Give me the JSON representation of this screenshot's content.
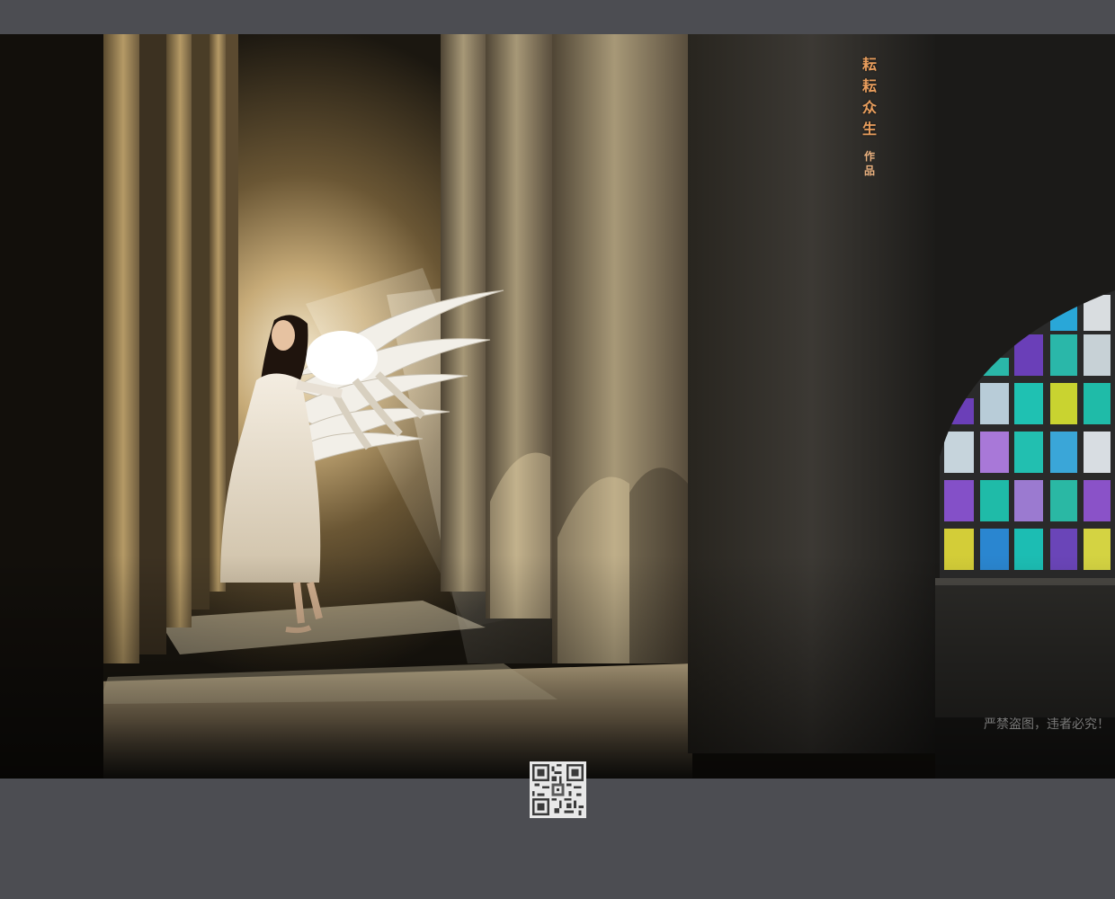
{
  "title_chars": [
    "耘",
    "耘",
    "众",
    "生"
  ],
  "works_chars": [
    "作",
    "品"
  ],
  "watermark_text": "严禁盗图，违者必究！",
  "scene_icons": {
    "photo": "angel-dancer-photo-icon",
    "qr": "qr-code-icon"
  },
  "colors": {
    "frame": "#4c4d52",
    "title": "#e99e5d",
    "watermark": "#cdcdcd"
  }
}
